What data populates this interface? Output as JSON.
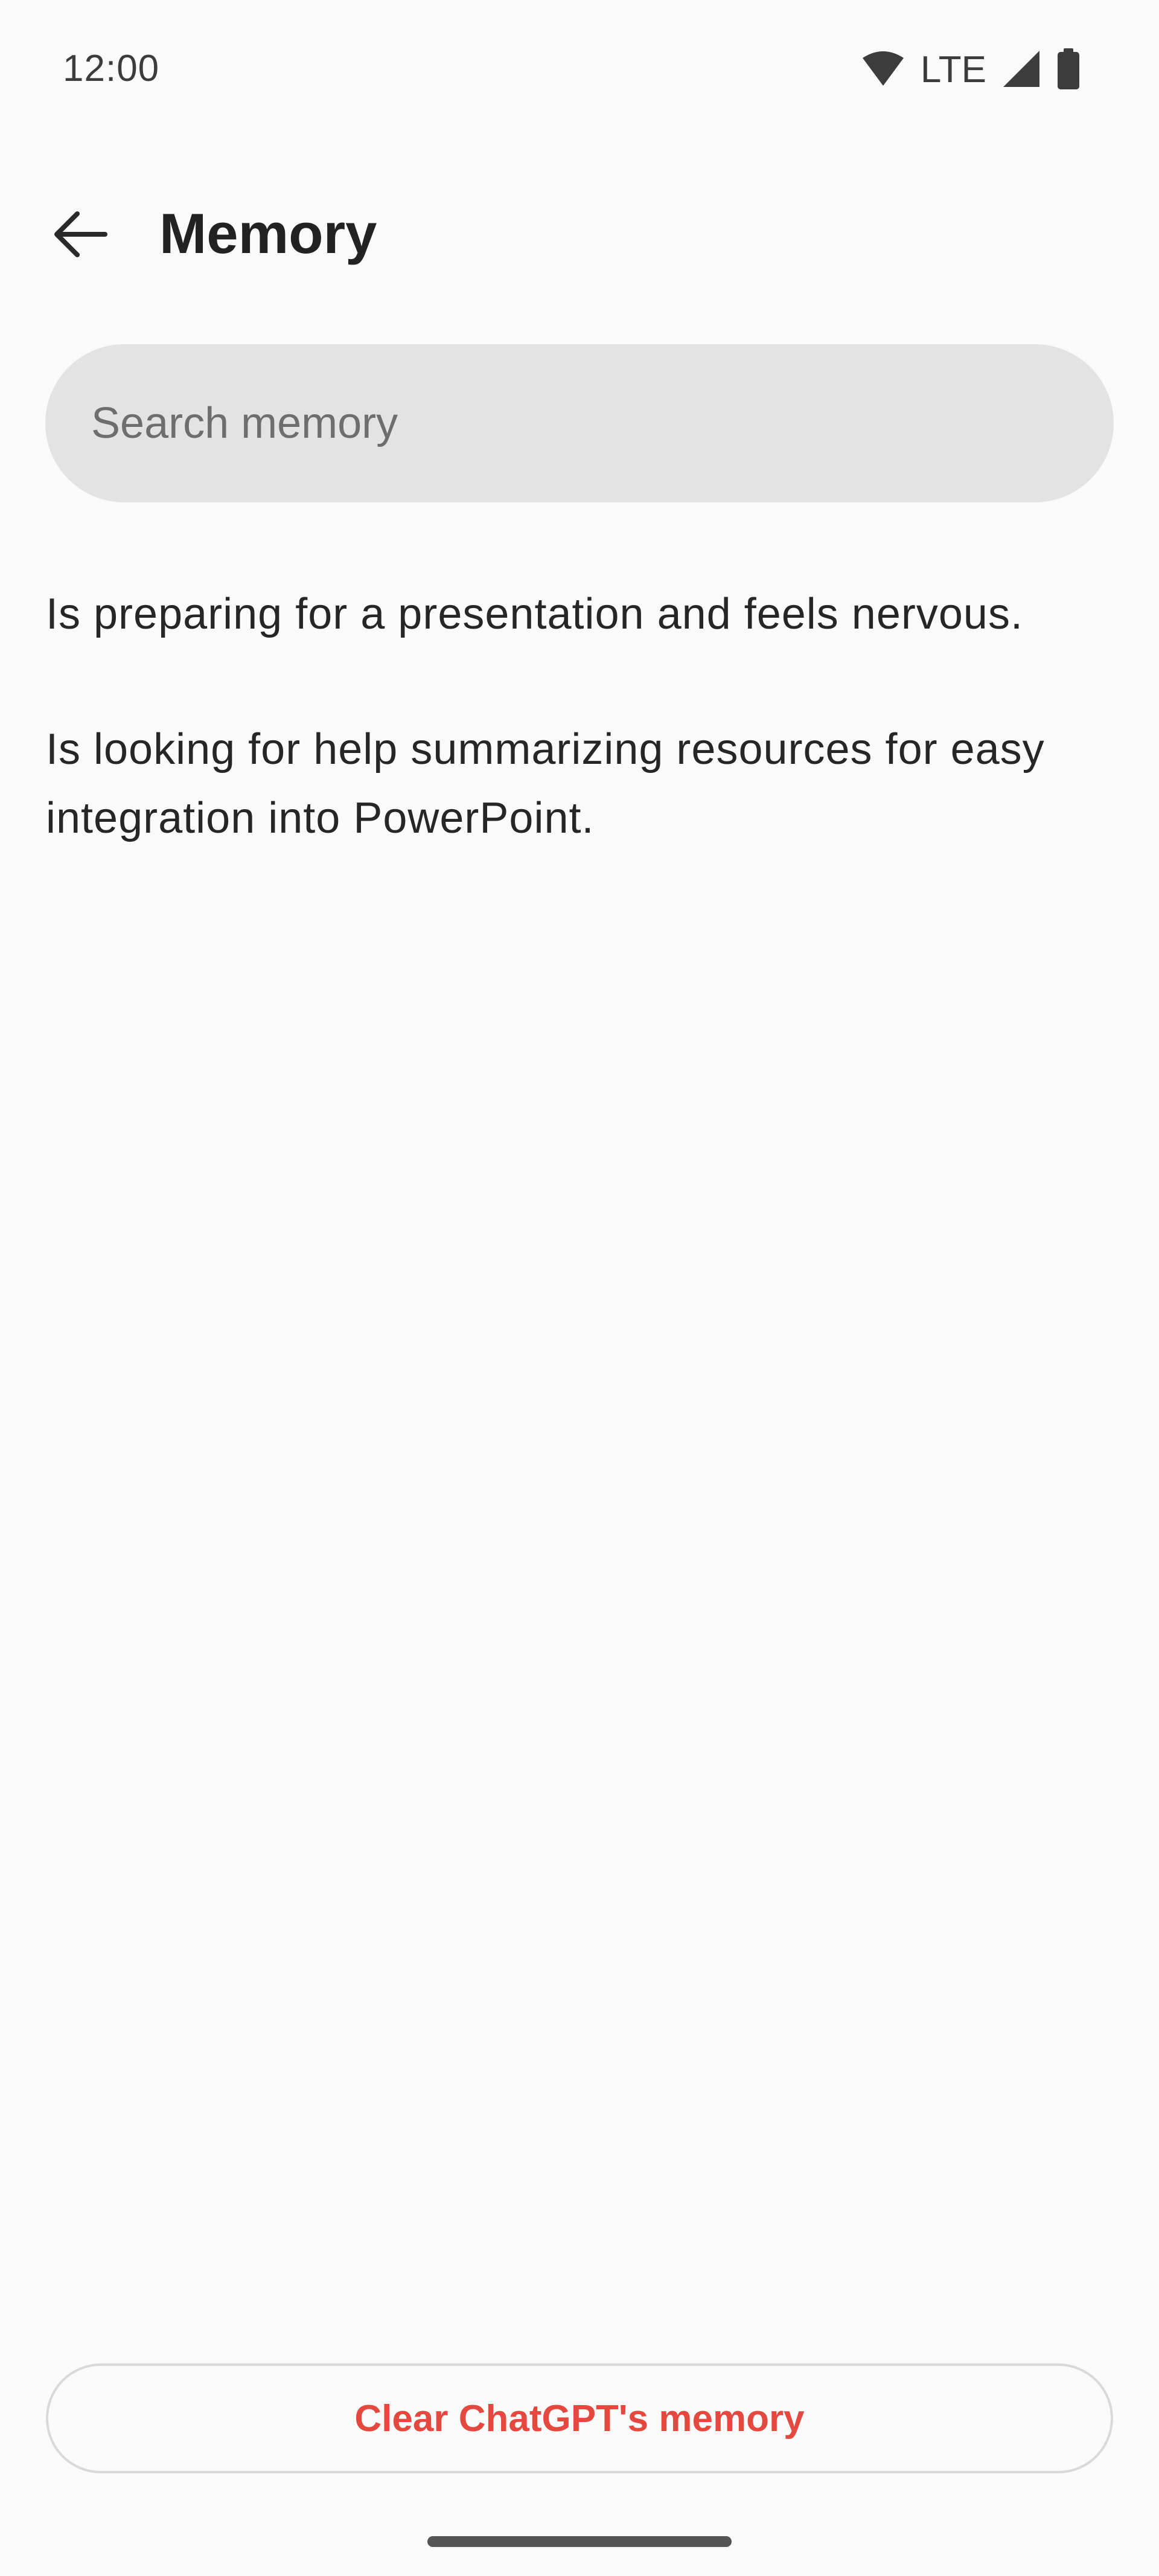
{
  "status_bar": {
    "time": "12:00",
    "network": "LTE",
    "icons": [
      "wifi-icon",
      "cell-signal-icon",
      "battery-icon"
    ]
  },
  "header": {
    "back_icon": "arrow-left-icon",
    "title": "Memory"
  },
  "search": {
    "placeholder": "Search memory",
    "value": ""
  },
  "memories": [
    {
      "text": "Is preparing for a presentation and feels nervous."
    },
    {
      "text": "Is looking for help summarizing resources for easy integration into PowerPoint."
    }
  ],
  "footer": {
    "clear_label": "Clear ChatGPT's memory"
  },
  "colors": {
    "background": "#fafafa",
    "search_fill": "#e3e3e3",
    "destructive": "#e5483f",
    "text_primary": "#262626"
  }
}
